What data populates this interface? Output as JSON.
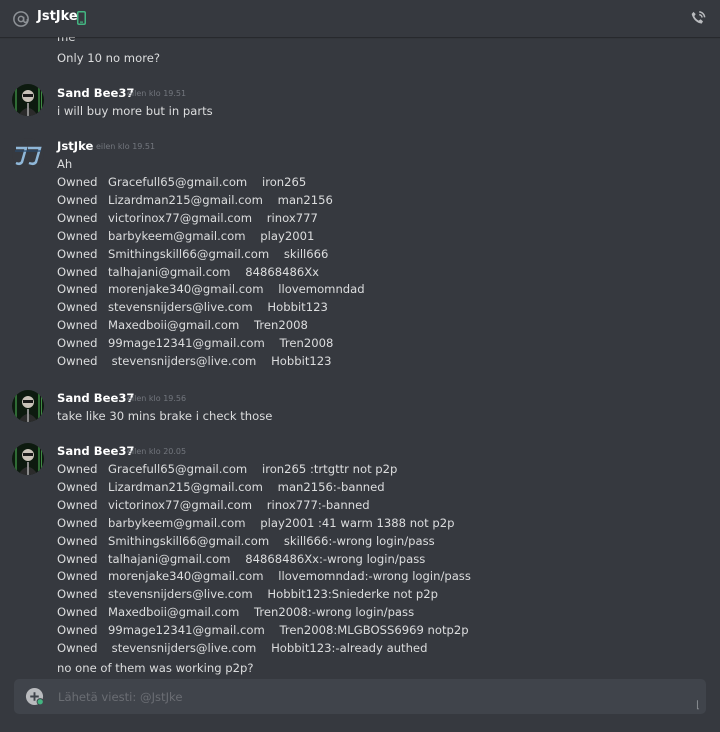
{
  "header": {
    "at_icon": "at-sign-icon",
    "name": "JstJke",
    "mobile_icon": "mobile-phone-icon",
    "call_icon": "phone-call-icon",
    "colors": {
      "mobile": "#43b581"
    }
  },
  "messages": {
    "top_cut": "me",
    "top_line": "Only 10 no more?",
    "msg1": {
      "author": "Sand Bee37",
      "time": "eilen klo 19.51",
      "text": "i will buy more but in parts"
    },
    "msg2": {
      "author": "JstJke",
      "time": "eilen klo 19.51",
      "first": "Ah",
      "rows": [
        [
          "Owned",
          "Gracefull65@gmail.com    iron265"
        ],
        [
          "Owned",
          "Lizardman215@gmail.com    man2156"
        ],
        [
          "Owned",
          "victorinox77@gmail.com    rinox777"
        ],
        [
          "Owned",
          "barbykeem@gmail.com    play2001"
        ],
        [
          "Owned",
          "Smithingskill66@gmail.com    skill666"
        ],
        [
          "Owned",
          "talhajani@gmail.com    84868486Xx"
        ],
        [
          "Owned",
          "morenjake340@gmail.com    llovemomndad"
        ],
        [
          "Owned",
          "stevensnijders@live.com    Hobbit123"
        ],
        [
          "Owned",
          "Maxedboii@gmail.com    Tren2008"
        ],
        [
          "Owned",
          "99mage12341@gmail.com    Tren2008"
        ],
        [
          "Owned",
          " stevensnijders@live.com    Hobbit123"
        ]
      ]
    },
    "msg3": {
      "author": "Sand Bee37",
      "time": "eilen klo 19.56",
      "text": "take like 30 mins brake i check those"
    },
    "msg4": {
      "author": "Sand Bee37",
      "time": "eilen klo 20.05",
      "rows": [
        [
          "Owned",
          "Gracefull65@gmail.com    iron265 :trtgttr not p2p"
        ],
        [
          "Owned",
          "Lizardman215@gmail.com    man2156:-banned"
        ],
        [
          "Owned",
          "victorinox77@gmail.com    rinox777:-banned"
        ],
        [
          "Owned",
          "barbykeem@gmail.com    play2001 :41 warm 1388 not p2p"
        ],
        [
          "Owned",
          "Smithingskill66@gmail.com    skill666:-wrong login/pass"
        ],
        [
          "Owned",
          "talhajani@gmail.com    84868486Xx:-wrong login/pass"
        ],
        [
          "Owned",
          "morenjake340@gmail.com    llovemomndad:-wrong login/pass"
        ],
        [
          "Owned",
          "stevensnijders@live.com    Hobbit123:Sniederke not p2p"
        ],
        [
          "Owned",
          "Maxedboii@gmail.com    Tren2008:-wrong login/pass"
        ],
        [
          "Owned",
          "99mage12341@gmail.com    Tren2008:MLGBOSS6969 notp2p"
        ],
        [
          "Owned",
          " stevensnijders@live.com    Hobbit123:-already authed"
        ]
      ],
      "last": "no one of them was working p2p?"
    }
  },
  "composer": {
    "plus_icon": "add-attachment-icon",
    "placeholder": "Lähetä viesti: @JstJke"
  }
}
